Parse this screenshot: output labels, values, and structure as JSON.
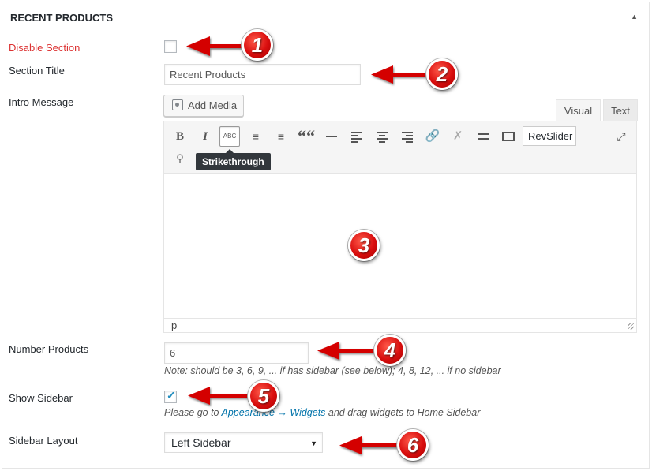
{
  "section": {
    "title": "RECENT PRODUCTS",
    "toggle_icon": "triangle-up"
  },
  "fields": {
    "disable_section": {
      "label": "Disable Section",
      "checked": false
    },
    "section_title": {
      "label": "Section Title",
      "value": "Recent Products"
    },
    "intro_message": {
      "label": "Intro Message",
      "add_media": "Add Media",
      "tabs": [
        "Visual",
        "Text"
      ],
      "active_tab": "Visual",
      "toolbar": [
        "B",
        "I",
        "ABC",
        "bullet-list",
        "numbered-list",
        "““",
        "horizontal-rule",
        "align-left",
        "align-center",
        "align-right",
        "link",
        "unlink",
        "read-more",
        "toolbar-toggle"
      ],
      "revslider": "RevSlider",
      "tooltip": "Strikethrough",
      "path": "p"
    },
    "number_products": {
      "label": "Number Products",
      "value": "6",
      "note": "Note: should be 3, 6, 9, ... if has sidebar (see below); 4, 8, 12, ... if no sidebar"
    },
    "show_sidebar": {
      "label": "Show Sidebar",
      "checked": true,
      "note_pre": "Please go to ",
      "note_link": "Appearance → Widgets",
      "note_post": " and drag widgets to Home Sidebar"
    },
    "sidebar_layout": {
      "label": "Sidebar Layout",
      "selected": "Left Sidebar"
    }
  },
  "annotations": [
    "1",
    "2",
    "3",
    "4",
    "5",
    "6"
  ],
  "colors": {
    "required_label": "#dc3232",
    "arrow": "#d40000",
    "link": "#0073aa",
    "checkbox_tick": "#1e8cbe"
  }
}
